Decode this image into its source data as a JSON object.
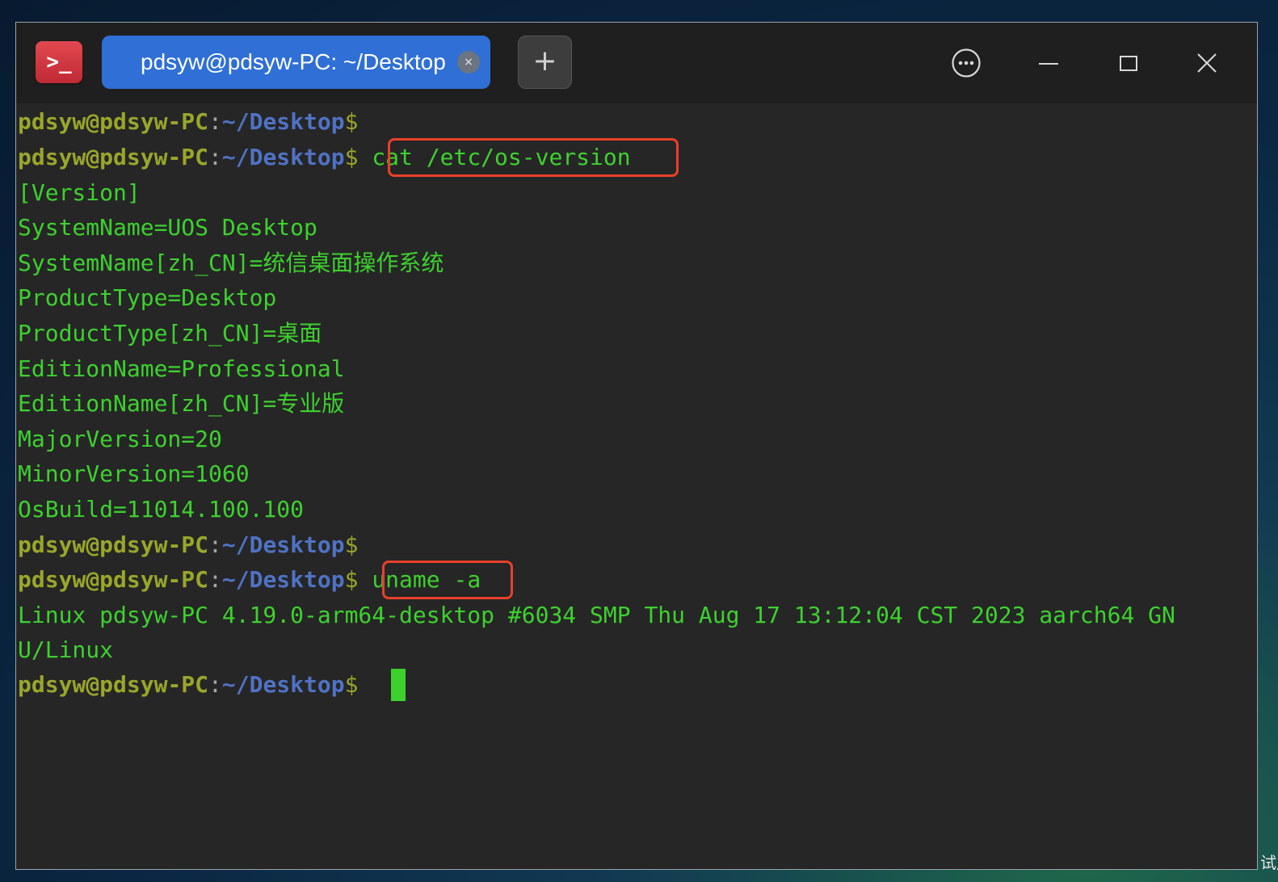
{
  "window": {
    "tab_title": "pdsyw@pdsyw-PC: ~/Desktop",
    "tab_close": "×",
    "add_tab": "+"
  },
  "prompt": {
    "user": "pdsyw@pdsyw-PC",
    "colon": ":",
    "path": "~/Desktop",
    "dollar": "$ "
  },
  "terminal": {
    "cmd1": "cat /etc/os-version",
    "output1": [
      "[Version]",
      "SystemName=UOS Desktop",
      "SystemName[zh_CN]=统信桌面操作系统",
      "ProductType=Desktop",
      "ProductType[zh_CN]=桌面",
      "EditionName=Professional",
      "EditionName[zh_CN]=专业版",
      "MajorVersion=20",
      "MinorVersion=1060",
      "OsBuild=11014.100.100"
    ],
    "cmd2": "uname -a",
    "output2": [
      "Linux pdsyw-PC 4.19.0-arm64-desktop #6034 SMP Thu Aug 17 13:12:04 CST 2023 aarch64 GN",
      "U/Linux"
    ]
  },
  "desktop": {
    "corner_text": "试用"
  },
  "colors": {
    "output_green": "#3dd12e",
    "prompt_user": "#9aa62a",
    "prompt_path": "#4f72c4",
    "highlight_box": "#e8402a",
    "tab_active": "#2f6fd6"
  }
}
